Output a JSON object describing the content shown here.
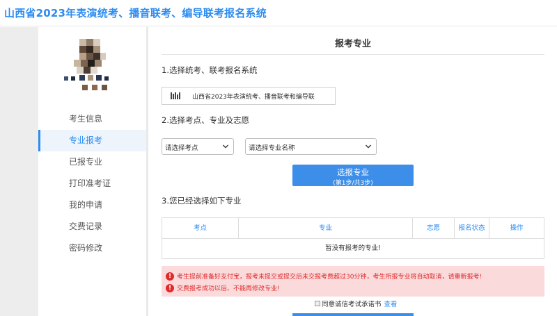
{
  "header": {
    "title": "山西省2023年表演统考、播音联考、编导联考报名系统"
  },
  "sidebar": {
    "items": [
      {
        "label": "考生信息",
        "active": false
      },
      {
        "label": "专业报考",
        "active": true
      },
      {
        "label": "已报专业",
        "active": false
      },
      {
        "label": "打印准考证",
        "active": false
      },
      {
        "label": "我的申请",
        "active": false
      },
      {
        "label": "交费记录",
        "active": false
      },
      {
        "label": "密码修改",
        "active": false
      }
    ]
  },
  "main": {
    "title": "报考专业",
    "step1": {
      "label": "1.选择统考、联考报名系统",
      "system_text": "山西省2023年表演统考、播音联考和编导联"
    },
    "step2": {
      "label": "2.选择考点、专业及志愿",
      "site_select": "请选择考点",
      "major_select": "请选择专业名称",
      "button_line1": "选报专业",
      "button_line2": "(第1步/共3步)"
    },
    "step3": {
      "label": "3.您已经选择如下专业",
      "columns": [
        "考点",
        "专业",
        "志愿",
        "报名状态",
        "操作"
      ],
      "empty_text": "暂没有报考的专业!"
    },
    "alerts": [
      "考生提前准备好支付宝，报考未提交或提交后未交报考费超过30分钟，考生所报专业将自动取消，请重新报考!",
      "交费报考成功以后、不能再修改专业!"
    ],
    "agreement": {
      "text": "同意诚信考试承诺书",
      "link": "查看"
    }
  },
  "colors": {
    "accent": "#2d8cf0",
    "button": "#3d8ee8",
    "alert_bg": "#fadadb",
    "alert_text": "#e02b2b"
  }
}
